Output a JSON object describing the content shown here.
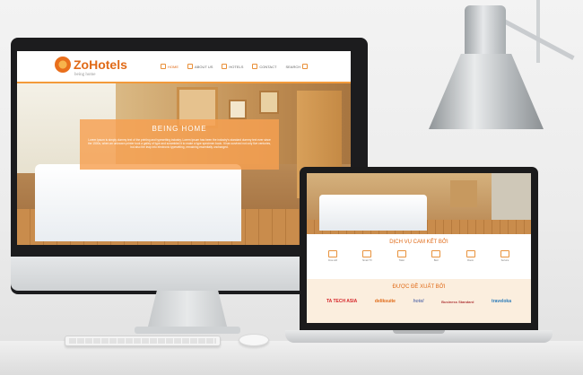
{
  "desktop_site": {
    "logo": {
      "name": "ZoHotels",
      "tagline": "being home"
    },
    "nav": [
      {
        "label": "HOME",
        "icon": "home-icon"
      },
      {
        "label": "ABOUT US",
        "icon": "user-icon"
      },
      {
        "label": "HOTELS",
        "icon": "hotel-icon"
      },
      {
        "label": "CONTACT",
        "icon": "mail-icon"
      },
      {
        "label": "SEARCH",
        "icon": "search-icon"
      }
    ],
    "hero": {
      "title": "BEING HOME",
      "text": "Lorem Ipsum is simply dummy text of the printing and typesetting industry. Lorem Ipsum has been the industry's standard dummy text ever since the 1500s, when an unknown printer took a galley of type and scrambled it to make a type specimen book. It has survived not only five centuries, but also the leap into electronic typesetting, remaining essentially unchanged."
    }
  },
  "laptop_site": {
    "services_title": "DỊCH VỤ CAM KẾT BỞI",
    "services": [
      "Free wifi",
      "Smart TV",
      "Toilet",
      "Bed",
      "Room",
      "Service"
    ],
    "partners_title": "ĐƯỢC ĐỀ XUẤT BỞI",
    "partners": [
      "TA TECH ASIA",
      "deliksuite",
      "hotel",
      "Business Standard",
      "traveloka"
    ]
  },
  "colors": {
    "brand": "#e06a17",
    "accent": "#f39a3a"
  }
}
